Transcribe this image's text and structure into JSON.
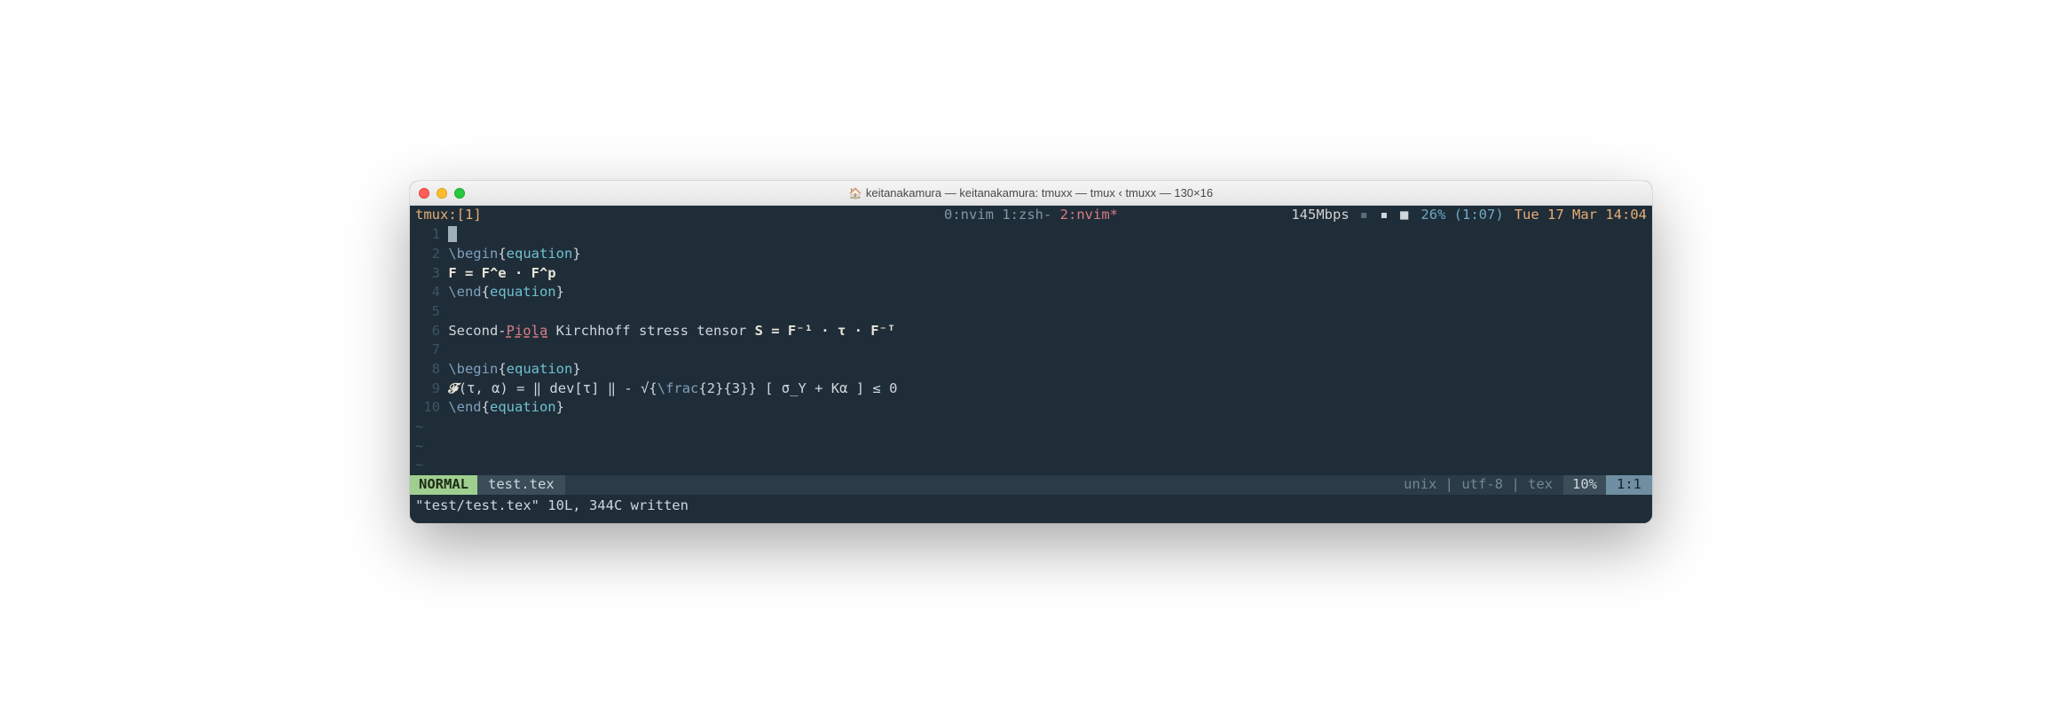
{
  "window": {
    "title": "keitanakamura — keitanakamura: tmuxx — tmux ‹ tmuxx — 130×16"
  },
  "tmux": {
    "session": "tmux:[1]",
    "tabs": {
      "t0": "0:nvim",
      "t1": "1:zsh-",
      "t2": "2:nvim*"
    },
    "speed": "145Mbps",
    "battery": "26% (1:07)",
    "date": "Tue 17 Mar 14:04"
  },
  "lines": {
    "n1": "1",
    "n2": "2",
    "n3": "3",
    "n4": "4",
    "n5": "5",
    "n6": "6",
    "n7": "7",
    "n8": "8",
    "n9": "9",
    "n10": "10",
    "begin": "\\begin",
    "end": "\\end",
    "frac": "\\frac",
    "eq": "equation",
    "lb": "{",
    "rb": "}",
    "l3a": "F = F^e · F^p",
    "l6a": "Second-",
    "l6b": "Piola",
    "l6c": " Kirchhoff stress tensor ",
    "l6d": "S = F⁻¹ · τ · F⁻ᵀ",
    "l9a": "𝓕",
    "l9b": "(τ, α) = ‖ dev[τ] ‖ - √{",
    "l9c": "2",
    "l9d": "3",
    "l9e": "} [ σ_Y + Kα ] ≤ 0",
    "tilde": "~"
  },
  "status": {
    "mode": "NORMAL",
    "file": "test.tex",
    "info": "unix | utf-8 | tex",
    "pct": "10%",
    "pos": "1:1"
  },
  "message": "\"test/test.tex\" 10L, 344C written"
}
